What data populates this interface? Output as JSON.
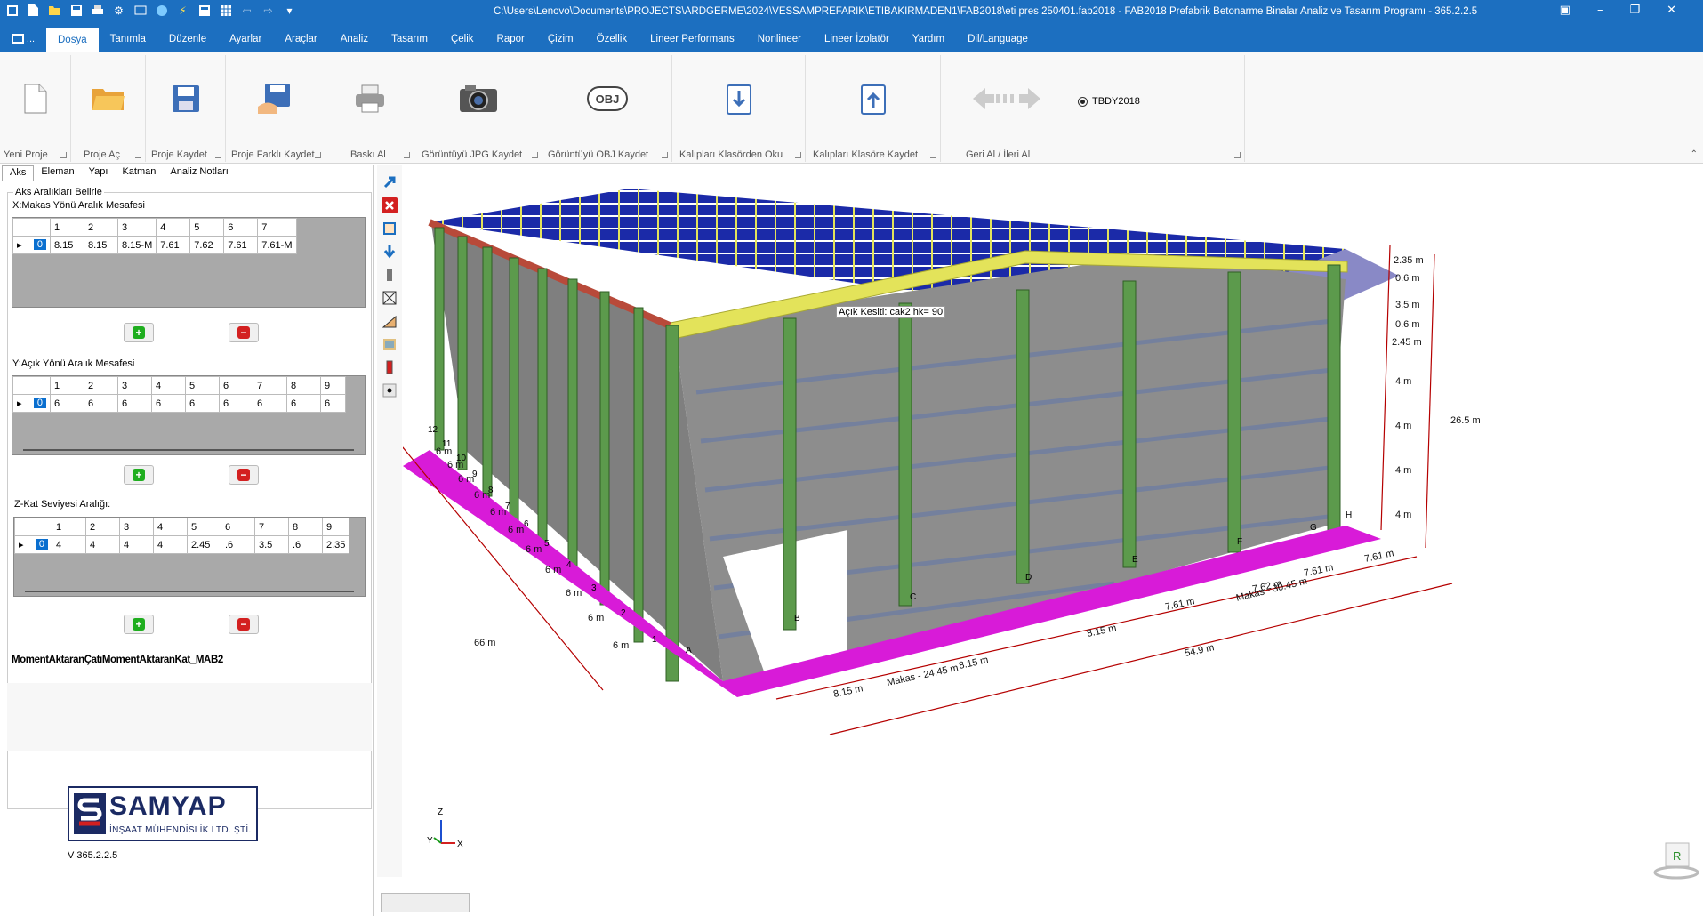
{
  "quick_access": {
    "icons": [
      "app-logo-icon",
      "new-file-icon",
      "open-folder-icon",
      "save-icon",
      "print-icon",
      "gear-icon",
      "screen-icon",
      "globe-icon",
      "bolt-icon",
      "calc-icon",
      "grid-icon",
      "undo-icon",
      "redo-icon",
      "dropdown-icon"
    ]
  },
  "title": "C:\\Users\\Lenovo\\Documents\\PROJECTS\\ARDGERME\\2024\\VESSAMPREFARIK\\ETIBAKIRMADEN1\\FAB2018\\eti pres 250401.fab2018 - FAB2018 Prefabrik Betonarme Binalar Analiz ve Tasarım Programı - 365.2.2.5",
  "app_button": "...",
  "menu": [
    "Dosya",
    "Tanımla",
    "Düzenle",
    "Ayarlar",
    "Araçlar",
    "Analiz",
    "Tasarım",
    "Çelik",
    "Rapor",
    "Çizim",
    "Özellik",
    "Lineer Performans",
    "Nonlineer",
    "Lineer İzolatör",
    "Yardım",
    "Dil/Language"
  ],
  "ribbon": {
    "groups": [
      {
        "label": "Yeni Proje",
        "icon": "new-file-icon"
      },
      {
        "label": "Proje Aç",
        "icon": "open-folder-icon"
      },
      {
        "label": "Proje Kaydet",
        "icon": "save-icon"
      },
      {
        "label": "Proje Farklı Kaydet",
        "icon": "save-as-icon"
      },
      {
        "label": "Baskı Al",
        "icon": "printer-icon"
      },
      {
        "label": "Görüntüyü JPG Kaydet",
        "icon": "camera-icon"
      },
      {
        "label": "Görüntüyü OBJ Kaydet",
        "icon": "obj-icon"
      },
      {
        "label": "Kalıpları Klasörden Oku",
        "icon": "import-icon"
      },
      {
        "label": "Kalıpları Klasöre Kaydet",
        "icon": "export-icon"
      },
      {
        "label": "Geri Al / İleri Al",
        "icon": "undo-redo-icon"
      }
    ],
    "code_option": "TBDY2018"
  },
  "left_panel": {
    "tabs": [
      "Aks",
      "Eleman",
      "Yapı",
      "Katman",
      "Analiz Notları"
    ],
    "frame_title": "Aks Aralıkları Belirle",
    "x_section": {
      "title": "X:Makas Yönü Aralık Mesafesi",
      "headers": [
        "1",
        "2",
        "3",
        "4",
        "5",
        "6",
        "7"
      ],
      "row_label": "0",
      "values": [
        "8.15",
        "8.15",
        "8.15-M",
        "7.61",
        "7.62",
        "7.61",
        "7.61-M"
      ]
    },
    "y_section": {
      "title": "Y:Açık Yönü Aralık Mesafesi",
      "headers": [
        "1",
        "2",
        "3",
        "4",
        "5",
        "6",
        "7",
        "8",
        "9"
      ],
      "row_label": "0",
      "values": [
        "6",
        "6",
        "6",
        "6",
        "6",
        "6",
        "6",
        "6",
        "6"
      ]
    },
    "z_section": {
      "title": "Z-Kat Seviyesi Aralığı:",
      "headers": [
        "1",
        "2",
        "3",
        "4",
        "5",
        "6",
        "7",
        "8",
        "9"
      ],
      "row_label": "0",
      "values": [
        "4",
        "4",
        "4",
        "4",
        "2.45",
        ".6",
        "3.5",
        ".6",
        "2.35"
      ]
    },
    "moment_label": "MomentAktaranÇatıMomentAktaranKat_MAB2",
    "logo": {
      "name": "SAMYAP",
      "sub": "İNŞAAT MÜHENDİSLİK LTD. ŞTİ."
    },
    "version": "V 365.2.2.5"
  },
  "viewport": {
    "tooltip": "Açık Kesiti: cak2 hk= 90",
    "dims": {
      "y_spacing": [
        "6 m",
        "6 m",
        "6 m",
        "6 m",
        "6 m",
        "6 m",
        "6 m",
        "6 m",
        "6 m",
        "6 m",
        "6 m"
      ],
      "y_total": "66 m",
      "x_spacing": [
        "8.15 m",
        "8.15 m",
        "8.15 m",
        "7.61 m",
        "7.62 m",
        "7.61 m",
        "7.61 m"
      ],
      "makas_left": "Makas - 24.45 m",
      "makas_right": "Makas - 30.45 m",
      "x_total": "54.9 m",
      "z_levels": [
        "2.35 m",
        "0.6 m",
        "3.5 m",
        "0.6 m",
        "2.45 m",
        "4 m",
        "4 m",
        "4 m",
        "4 m"
      ],
      "z_total": "26.5 m"
    },
    "axis_labels_x": [
      "A",
      "B",
      "C",
      "D",
      "E",
      "F",
      "G",
      "H"
    ],
    "axis_labels_y": [
      "1",
      "2",
      "3",
      "4",
      "5",
      "6",
      "7",
      "8",
      "9",
      "10",
      "11",
      "12"
    ],
    "axis_indicator": {
      "z": "Z",
      "y": "Y",
      "x": "X"
    }
  },
  "colors": {
    "accent": "#1c6fc0",
    "foundation": "#d81bd8",
    "column": "#5c9a4c",
    "wall": "#8d8d8d",
    "roof_beam": "#e3e35a",
    "purlin": "#ffffff",
    "roof_panel": "#1b2aa8",
    "dim_line": "#b50000"
  }
}
